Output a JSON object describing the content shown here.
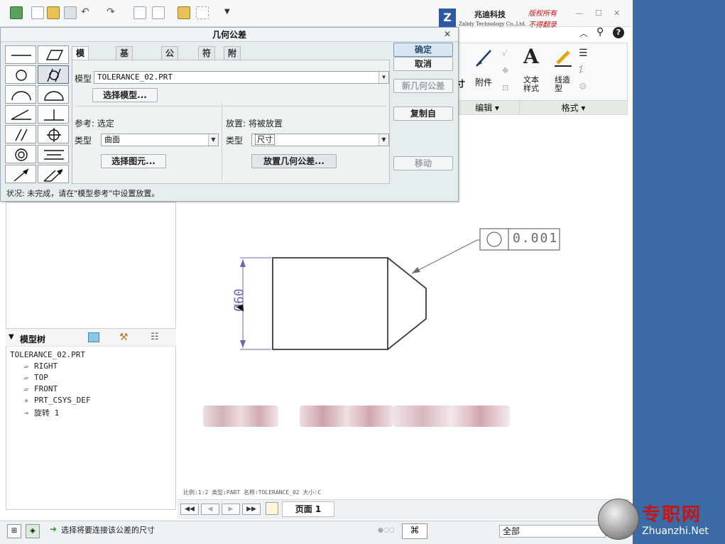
{
  "brand": {
    "name_cn": "兆迪科技",
    "name_en": "Zalidy Technology Co.,Ltd.",
    "rights_1": "版权所有",
    "rights_2": "不得翻录"
  },
  "ribbon": {
    "attach": "附件",
    "text_style": "文本\n样式",
    "line_style": "线造\n型",
    "group_edit": "编辑 ▾",
    "group_format": "格式 ▾",
    "partial_label": "寸"
  },
  "dialog": {
    "title": "几何公差",
    "tabs": [
      "模型参考",
      "基准参考",
      "公差值",
      "符号",
      "附加文本"
    ],
    "model_label": "模型",
    "model_value": "TOLERANCE_02.PRT",
    "select_model_btn": "选择模型...",
    "ref_label": "参考: 选定",
    "ref_type_label": "类型",
    "ref_type_value": "曲面",
    "select_entity_btn": "选择图元...",
    "place_label": "放置: 将被放置",
    "place_type_label": "类型",
    "place_type_value": "尺寸",
    "place_btn": "放置几何公差...",
    "ok": "确定",
    "cancel": "取消",
    "new_tol": "新几何公差",
    "copy_from": "复制自",
    "move": "移动",
    "status": "状况: 未完成，请在\"模型参考\"中设置放置。"
  },
  "model_tree": {
    "title": "模型树",
    "root": "TOLERANCE_02.PRT",
    "items": [
      "RIGHT",
      "TOP",
      "FRONT",
      "PRT_CSYS_DEF",
      "旋转 1"
    ]
  },
  "drawing": {
    "dimension": "Ø60",
    "fcf_value": "0.001",
    "meta": "比例:1:2     类型:PART   名称:TOLERANCE_02   大小:C"
  },
  "pagebar": {
    "page_label": "页面 1"
  },
  "statusbar": {
    "message": "选择将要连接该公差的尺寸",
    "filter": "全部"
  },
  "watermark": {
    "cn": "专职网",
    "en": "Zhuanzhi.Net"
  }
}
